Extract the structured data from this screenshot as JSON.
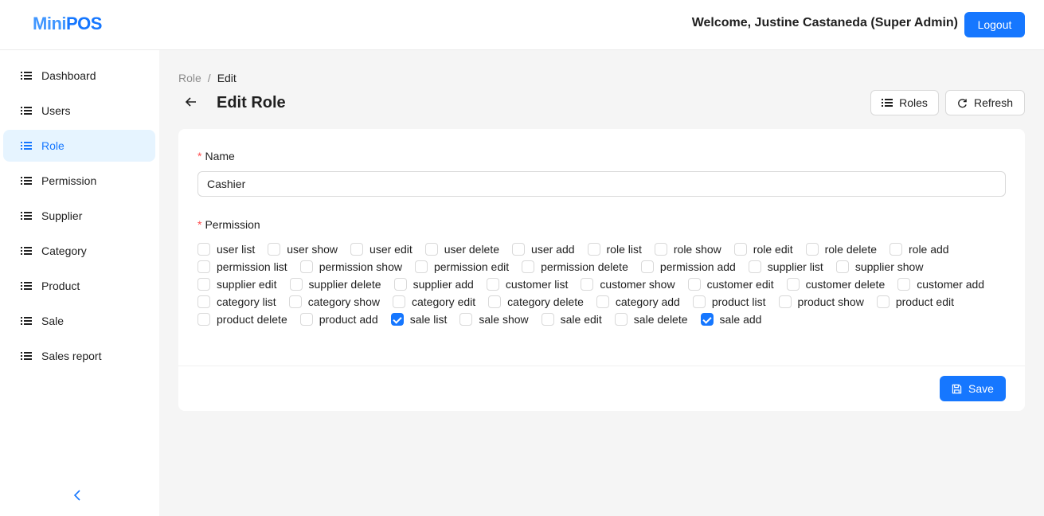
{
  "app": {
    "logo_part1": "Mini",
    "logo_part2": "POS"
  },
  "header": {
    "welcome": "Welcome, Justine Castaneda (Super Admin)",
    "logout_label": "Logout"
  },
  "sidebar": {
    "items": [
      {
        "label": "Dashboard",
        "active": false
      },
      {
        "label": "Users",
        "active": false
      },
      {
        "label": "Role",
        "active": true
      },
      {
        "label": "Permission",
        "active": false
      },
      {
        "label": "Supplier",
        "active": false
      },
      {
        "label": "Category",
        "active": false
      },
      {
        "label": "Product",
        "active": false
      },
      {
        "label": "Sale",
        "active": false
      },
      {
        "label": "Sales report",
        "active": false
      }
    ],
    "collapse_glyph": "<"
  },
  "breadcrumb": {
    "parent": "Role",
    "separator": "/",
    "current": "Edit"
  },
  "page": {
    "title": "Edit Role"
  },
  "toolbar": {
    "roles_label": "Roles",
    "refresh_label": "Refresh"
  },
  "form": {
    "name_label": "Name",
    "required_mark": "*",
    "name_value": "Cashier",
    "permission_label": "Permission",
    "save_label": "Save",
    "permission_rows": [
      [
        {
          "label": "user list",
          "checked": false
        },
        {
          "label": "user show",
          "checked": false
        },
        {
          "label": "user edit",
          "checked": false
        },
        {
          "label": "user delete",
          "checked": false
        },
        {
          "label": "user add",
          "checked": false
        },
        {
          "label": "role list",
          "checked": false
        },
        {
          "label": "role show",
          "checked": false
        },
        {
          "label": "role edit",
          "checked": false
        },
        {
          "label": "role delete",
          "checked": false
        },
        {
          "label": "role add",
          "checked": false
        }
      ],
      [
        {
          "label": "permission list",
          "checked": false
        },
        {
          "label": "permission show",
          "checked": false
        },
        {
          "label": "permission edit",
          "checked": false
        },
        {
          "label": "permission delete",
          "checked": false
        },
        {
          "label": "permission add",
          "checked": false
        },
        {
          "label": "supplier list",
          "checked": false
        },
        {
          "label": "supplier show",
          "checked": false
        }
      ],
      [
        {
          "label": "supplier edit",
          "checked": false
        },
        {
          "label": "supplier delete",
          "checked": false
        },
        {
          "label": "supplier add",
          "checked": false
        },
        {
          "label": "customer list",
          "checked": false
        },
        {
          "label": "customer show",
          "checked": false
        },
        {
          "label": "customer edit",
          "checked": false
        },
        {
          "label": "customer delete",
          "checked": false
        },
        {
          "label": "customer add",
          "checked": false
        }
      ],
      [
        {
          "label": "category list",
          "checked": false
        },
        {
          "label": "category show",
          "checked": false
        },
        {
          "label": "category edit",
          "checked": false
        },
        {
          "label": "category delete",
          "checked": false
        },
        {
          "label": "category add",
          "checked": false
        },
        {
          "label": "product list",
          "checked": false
        },
        {
          "label": "product show",
          "checked": false
        },
        {
          "label": "product edit",
          "checked": false
        }
      ],
      [
        {
          "label": "product delete",
          "checked": false
        },
        {
          "label": "product add",
          "checked": false
        },
        {
          "label": "sale list",
          "checked": true
        },
        {
          "label": "sale show",
          "checked": false
        },
        {
          "label": "sale edit",
          "checked": false
        },
        {
          "label": "sale delete",
          "checked": false
        },
        {
          "label": "sale add",
          "checked": true
        }
      ]
    ]
  },
  "colors": {
    "primary": "#1677ff",
    "active_bg": "#e6f4ff",
    "required": "#ff4d4f",
    "page_bg": "#f5f5f5"
  }
}
